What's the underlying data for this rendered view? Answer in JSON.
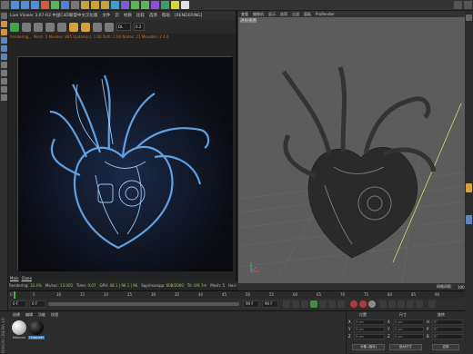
{
  "viewer": {
    "menu": [
      "Live Viewer 3.07-R2 中国C4D联盟中文汉化版",
      "文件",
      "云",
      "材质",
      "比较",
      "选项",
      "帮助",
      "[RENDERING]"
    ],
    "mode_select": "DL",
    "value_field": "0.2",
    "status": "Rendering…  Mesh: 5  Meshes: 885  Update[s]: 1.00  Path: 2.00  Nodes: 21  Movable: 2  4.0",
    "tabs": [
      "Main",
      "Clone"
    ],
    "stats": [
      {
        "label": "Rendering:",
        "value": "32.4%"
      },
      {
        "label": "Ms/sec:",
        "value": "13.005"
      },
      {
        "label": "Time:",
        "value": "0:07"
      },
      {
        "label": "GPU:",
        "value": "48  1 | 96  1 | 96"
      },
      {
        "label": "Spp/maxspp:",
        "value": "608/2000"
      },
      {
        "label": "Tri:",
        "value": "0/9.7m"
      },
      {
        "label": "Mesh:",
        "value": "5"
      },
      {
        "label": "Hair:",
        "value": "5466"
      }
    ]
  },
  "viewport": {
    "menu": [
      "查看",
      "摄像机",
      "显示",
      "选项",
      "过滤",
      "面板",
      "ProRender"
    ],
    "label": "透视视图",
    "grid_label": "网格间距：",
    "grid_value": "100 cm"
  },
  "timeline": {
    "ticks": [
      "0",
      "5",
      "10",
      "15",
      "20",
      "25",
      "30",
      "35",
      "40",
      "45",
      "50",
      "55",
      "60",
      "65",
      "70",
      "75",
      "80",
      "85",
      "90"
    ],
    "start": "0 F",
    "current": "0 F",
    "end_a": "90 F",
    "end_b": "90 F",
    "current_frame": "0 F"
  },
  "materials": {
    "menu": [
      "创建",
      "编辑",
      "功能",
      "纹理"
    ],
    "brand": "MAXON CINEMA 4D",
    "items": [
      {
        "name": "Material",
        "color": "#e7e7e7"
      },
      {
        "name": "OctaneM",
        "color": "#121212"
      }
    ]
  },
  "coords": {
    "header": [
      "位置",
      "尺寸",
      "旋转"
    ],
    "rows": [
      {
        "axis": "X",
        "pos": "0 cm",
        "size": "0 cm",
        "rot_axis": "H",
        "rot": "0°"
      },
      {
        "axis": "Y",
        "pos": "0 cm",
        "size": "0 cm",
        "rot_axis": "P",
        "rot": "0°"
      },
      {
        "axis": "Z",
        "pos": "0 cm",
        "size": "0 cm",
        "rot_axis": "B",
        "rot": "0°"
      }
    ],
    "mode_select": "对象 (相对)",
    "size_select": "绝对尺寸",
    "apply_button": "应用"
  }
}
